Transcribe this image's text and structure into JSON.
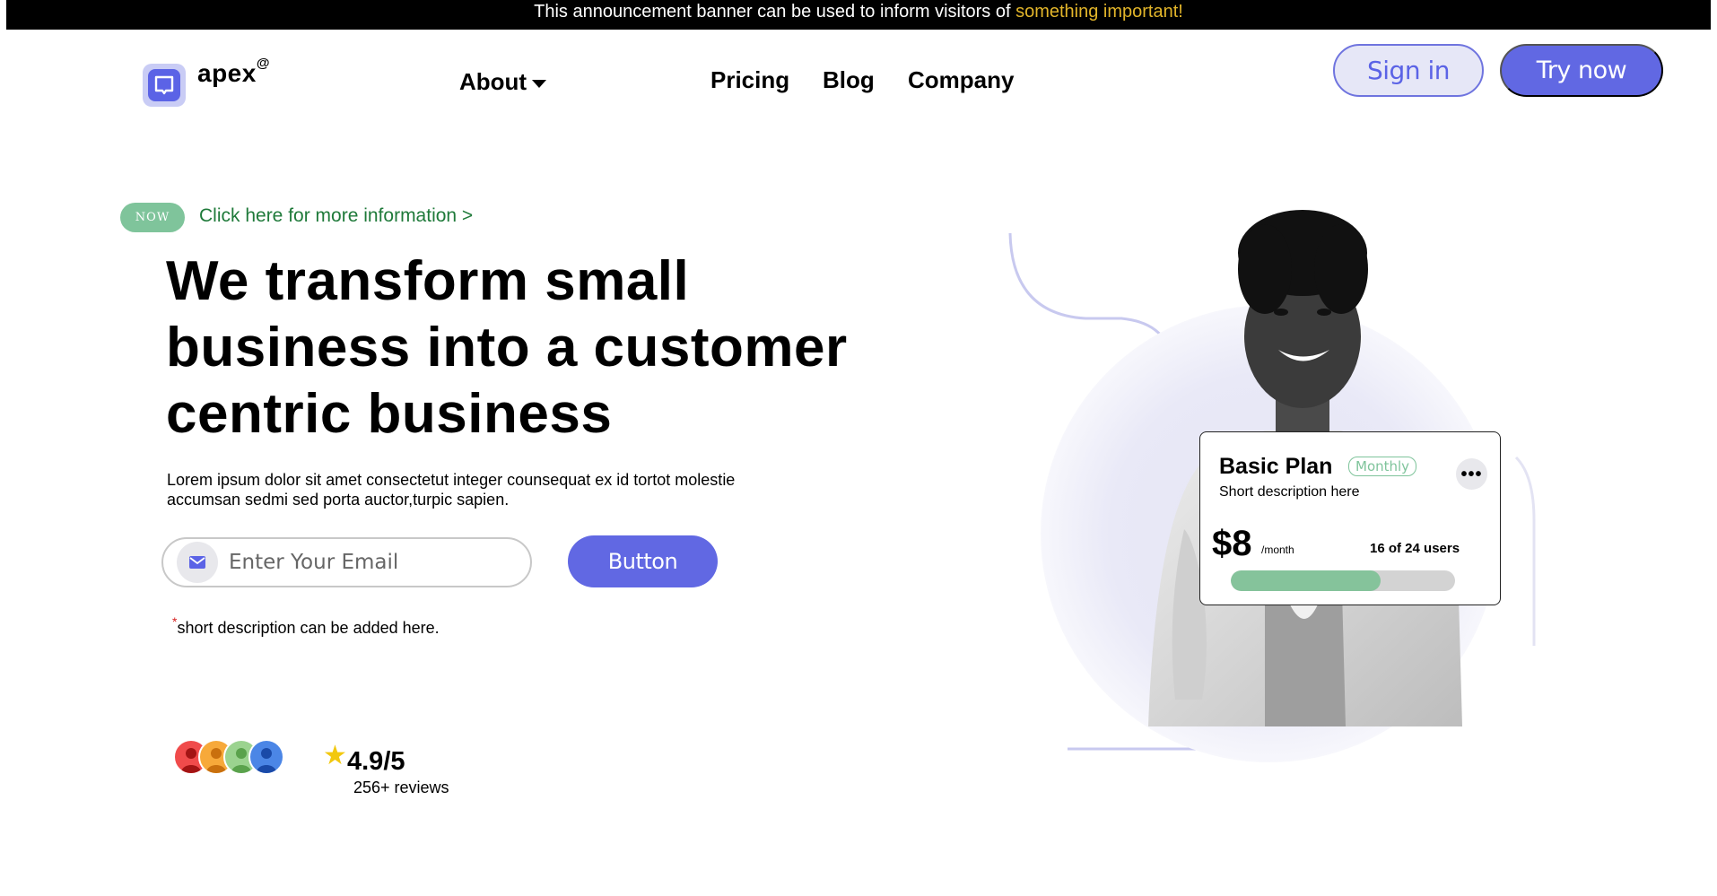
{
  "banner": {
    "text": "This announcement banner can be used to inform visitors of ",
    "highlight": "something important!"
  },
  "brand": {
    "name": "apex",
    "mark": "@",
    "icon": "chat-bubble-icon",
    "accent": "#5b63e6"
  },
  "nav": {
    "about": "About",
    "pricing": "Pricing",
    "blog": "Blog",
    "company": "Company"
  },
  "header_actions": {
    "signin": "Sign in",
    "try": "Try now"
  },
  "hero": {
    "badge": "NOW",
    "info_link": "Click here for more information >",
    "headline_lines": [
      "We transform small",
      "business into a customer",
      "centric business"
    ],
    "lead_lines": [
      "Lorem ipsum dolor sit amet consectetut integer counsequat ex id tortot molestie",
      "accumsan sedmi sed porta auctor,turpic sapien."
    ],
    "email_placeholder": "Enter Your Email",
    "email_icon": "envelope-icon",
    "button": "Button",
    "note_asterisk": "*",
    "note": "short description can be added here."
  },
  "social_proof": {
    "rating": "4.9/5",
    "reviews": "256+ reviews",
    "avatar_colors": [
      "#f04b4b",
      "#f7a93a",
      "#9bd38f",
      "#4b86e6"
    ]
  },
  "plan_card": {
    "title": "Basic Plan",
    "badge": "Monthly",
    "description": "Short description here",
    "more": "•••",
    "price": "$8",
    "period": "/month",
    "users": "16 of 24 users",
    "users_used": 16,
    "users_total": 24
  },
  "colors": {
    "primary": "#6168e3",
    "success": "#7fc49b",
    "banner_highlight": "#e2b52a",
    "link": "#1f7a3a"
  }
}
